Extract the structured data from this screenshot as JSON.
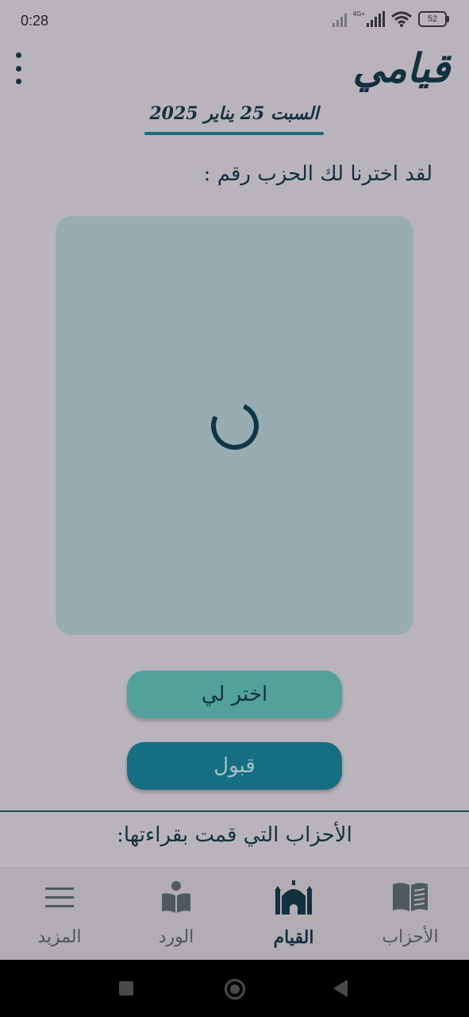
{
  "status_bar": {
    "time": "0:28",
    "network": "4G+",
    "battery": "52"
  },
  "header": {
    "app_title": "قيامي",
    "date": "السبت 25 يناير 2025"
  },
  "main": {
    "chosen_label": "لقد اخترنا لك الحزب رقم :",
    "choose_button": "اختر لي",
    "accept_button": "قبول",
    "read_heading": "الأحزاب التي قمت بقراءتها:"
  },
  "nav": {
    "items": [
      {
        "label": "الأحزاب",
        "icon": "open-book-icon"
      },
      {
        "label": "القيام",
        "icon": "mosque-icon",
        "active": true
      },
      {
        "label": "الورد",
        "icon": "reader-book-icon"
      },
      {
        "label": "المزيد",
        "icon": "hamburger-menu-icon"
      }
    ]
  },
  "colors": {
    "background": "#b9b4bb",
    "primary": "#12313f",
    "card": "#97adb1",
    "choose_button": "#52a29a",
    "accept_button": "#166e82"
  }
}
